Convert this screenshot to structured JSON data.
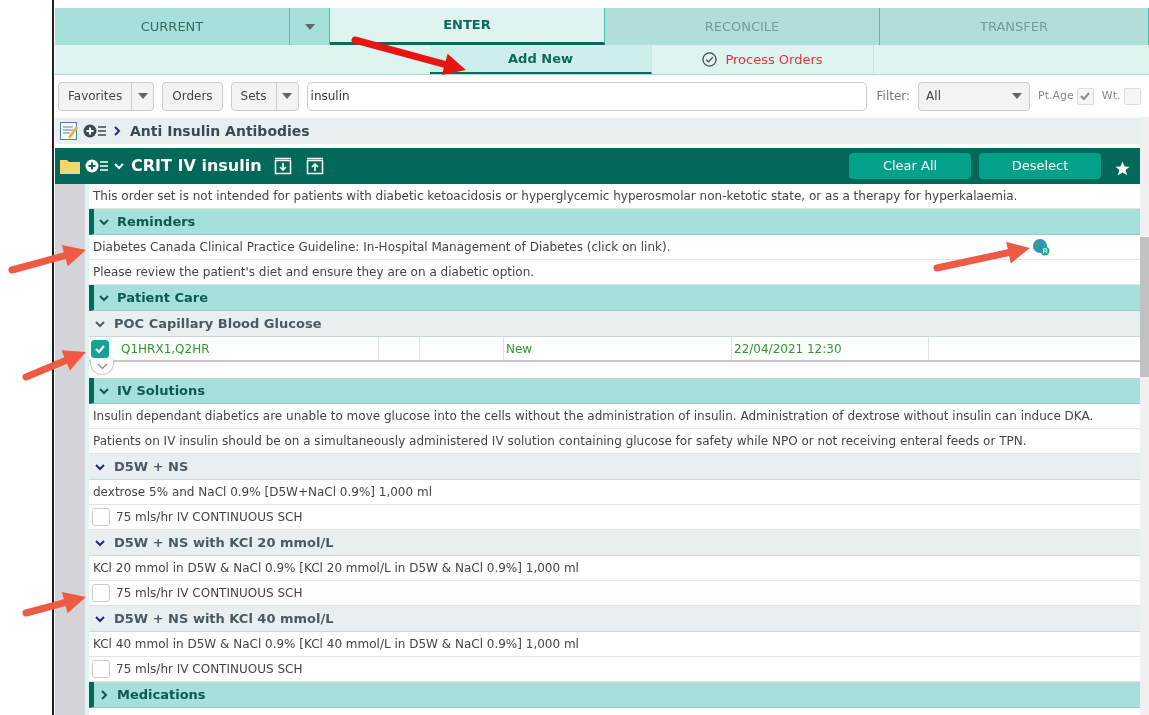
{
  "tabs": [
    {
      "label": "CURRENT",
      "selected": false,
      "dropdown": true
    },
    {
      "label": "ENTER",
      "selected": true,
      "dropdown": false
    },
    {
      "label": "RECONCILE",
      "selected": false,
      "dropdown": false
    },
    {
      "label": "TRANSFER",
      "selected": false,
      "dropdown": false
    }
  ],
  "subtabs": [
    {
      "label": "Add New",
      "selected": true,
      "alert": false,
      "icon": false
    },
    {
      "label": "Process Orders",
      "selected": false,
      "alert": true,
      "icon": true
    }
  ],
  "toolbar": {
    "buttons": [
      {
        "label": "Favorites",
        "dropdown": true
      },
      {
        "label": "Orders",
        "dropdown": false
      },
      {
        "label": "Sets",
        "dropdown": true
      }
    ],
    "search": {
      "value": "insulin"
    },
    "filter": {
      "label": "Filter:",
      "value": "All"
    },
    "checks": [
      {
        "label": "Pt.Age",
        "checked": true
      },
      {
        "label": "Wt.",
        "checked": false
      }
    ]
  },
  "results": [
    {
      "title": "Anti Insulin Antibodies",
      "expanded": false
    }
  ],
  "order_set": {
    "title": "CRIT IV insulin",
    "expanded": true,
    "buttons": [
      "Clear All",
      "Deselect"
    ],
    "favorite": true,
    "note": "This order set is not intended for patients with diabetic ketoacidosis or hyperglycemic hyperosmolar non-ketotic state, or as a therapy for hyperkalaemia.",
    "sections": [
      {
        "title": "Reminders",
        "expanded": true,
        "rows": [
          {
            "kind": "note",
            "text": "Diabetes Canada Clinical Practice Guideline: In-Hospital Management of Diabetes (click on link).",
            "link": true
          },
          {
            "kind": "note",
            "text": "Please review the patient's diet and ensure they are on a diabetic option.",
            "link": false
          }
        ]
      },
      {
        "title": "Patient Care",
        "expanded": true,
        "rows": [
          {
            "kind": "group",
            "title": "POC Capillary Blood Glucose",
            "expanded": true
          },
          {
            "kind": "order",
            "checked": true,
            "frequency": "Q1HRX1,Q2HR",
            "status": "New",
            "start": "22/04/2021 12:30"
          },
          {
            "kind": "more",
            "expanded": false
          }
        ]
      },
      {
        "title": "IV Solutions",
        "expanded": true,
        "rows": [
          {
            "kind": "note",
            "text": "Insulin dependant diabetics are unable to move glucose into the cells without the administration of insulin. Administration of dextrose without insulin can induce DKA.",
            "link": false
          },
          {
            "kind": "note",
            "text": "Patients on IV insulin should be on a simultaneously administered IV solution containing glucose for safety while NPO or not receiving enteral feeds or TPN.",
            "link": false
          },
          {
            "kind": "group",
            "title": "D5W + NS",
            "expanded": true
          },
          {
            "kind": "note",
            "text": "dextrose 5% and NaCl 0.9% [D5W+NaCl 0.9%] 1,000 ml",
            "link": false
          },
          {
            "kind": "option",
            "checked": false,
            "text": "75 mls/hr IV CONTINUOUS SCH"
          },
          {
            "kind": "group",
            "title": "D5W + NS with KCl 20 mmol/L",
            "expanded": true
          },
          {
            "kind": "note",
            "text": "KCl 20 mmol in D5W & NaCl 0.9% [KCl 20 mmol/L in D5W & NaCl 0.9%] 1,000 ml",
            "link": false
          },
          {
            "kind": "option",
            "checked": false,
            "text": "75 mls/hr IV CONTINUOUS SCH"
          },
          {
            "kind": "group",
            "title": "D5W + NS with KCl 40 mmol/L",
            "expanded": true
          },
          {
            "kind": "note",
            "text": "KCl 40 mmol in D5W & NaCl 0.9% [KCl 40 mmol/L in D5W & NaCl 0.9%] 1,000 ml",
            "link": false
          },
          {
            "kind": "option",
            "checked": false,
            "text": "75 mls/hr IV CONTINUOUS SCH"
          }
        ]
      },
      {
        "title": "Medications",
        "expanded": false
      }
    ]
  }
}
